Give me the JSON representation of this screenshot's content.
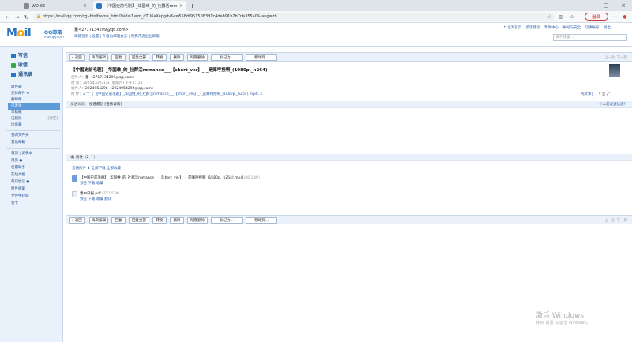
{
  "browser": {
    "tabs": [
      {
        "label": "WO-66",
        "active": false
      },
      {
        "label": "【中国史前毛剧】_华国维_的_社群活romance___",
        "active": true
      }
    ],
    "url": "https://mail.qq.com/cgi-bin/frame_html?sid=1wzn_dTU6aXepgdv&r=558df951508391c4dab91b2b7da355a0&lang=zh",
    "login_label": "登录"
  },
  "header": {
    "logo_text": "M",
    "logo_rest": "il",
    "logo_brand": "QQ邮箱",
    "logo_url": "mail.qq.com",
    "user": "董<2717134299@qq.com>",
    "user_links": "邮箱首页 | 设置 | 升级为邮箱会员 | 免费开通企业邮箱",
    "top_links": [
      "↑ 设为首页",
      "反馈建议",
      "帮助中心",
      "帐号与安全",
      "切换帐号",
      "退出"
    ],
    "search_placeholder": "邮件搜索..."
  },
  "sidebar": {
    "quick": [
      {
        "label": "写信",
        "color": "#2a74c6"
      },
      {
        "label": "收信",
        "color": "#3aa845"
      },
      {
        "label": "通讯录",
        "color": "#2a74c6"
      }
    ],
    "folders": [
      {
        "label": "收件箱",
        "right": ""
      },
      {
        "label": "星标邮件 ★",
        "right": ""
      },
      {
        "label": "群邮件",
        "right": ""
      },
      {
        "label": "已发送",
        "right": "",
        "active": true
      },
      {
        "label": "草稿箱",
        "right": ""
      },
      {
        "label": "已删除",
        "right": "[清空]"
      },
      {
        "label": "垃圾箱",
        "right": ""
      }
    ],
    "my_folders": [
      "我的文件夹",
      "其他邮箱"
    ],
    "apps": [
      "日历 | 记事本",
      "简历 ●",
      "发票助手",
      "在线文档",
      "每日悦读 ●",
      "附件收藏",
      "文件中转站",
      "贺卡"
    ]
  },
  "toolbar": {
    "buttons": [
      "« 返回",
      "再次编辑",
      "回复",
      "回复全部",
      "转发",
      "删除",
      "彻底删除",
      "标记为...",
      "移动到..."
    ],
    "pager": "上一封  下一封"
  },
  "mail": {
    "subject": "【中国史前毛剧】_华国维_的_社群活romance___【short_ver】_-_是嘛呼授啊_(1080p,_h264)",
    "from_label": "发件人：",
    "from": "董 <2717134299@qq.com>",
    "time_label": "时  间：",
    "time": "2025年5月31日 (星期六) 下午1：23",
    "to_label": "收件人：",
    "to": "2224954296 <2224954296@qq.com>",
    "attach_label": "附  件：",
    "attach_summary": "2 个（ 【中国史前毛剧】_华国维_的_社群活romance___【short_ver】_-_是嘛呼授啊_(1080p,_h264).mp4...）",
    "plain_text": "纯文本 |",
    "status_label": "发送状态：",
    "status": "投递成功 [查看详情]",
    "spam_hint": "什么是发送状态?"
  },
  "attachments": {
    "header": "附件（2 个）",
    "actions": "普通附件   ⬇ 全部下载   全部收藏",
    "items": [
      {
        "name": "【中国史前毛剧】_华国维_的_社群活romance___【short_ver】_-_是嘛呼授啊_(1080p,_h264).mp4",
        "size": "(46.14M)",
        "ops": "预览   下载   收藏"
      },
      {
        "name": "曹中日报.pdf",
        "size": "(752.53K)",
        "ops": "预览   下载   收藏   翻译"
      }
    ]
  },
  "windows": {
    "line1": "激活 Windows",
    "line2": "转到“设置”以激活 Windows。"
  }
}
